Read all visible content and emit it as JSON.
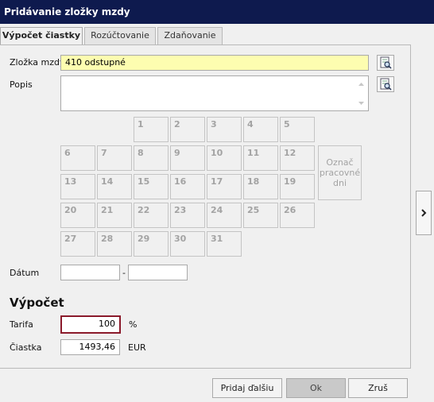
{
  "window": {
    "title": "Pridávanie zložky mzdy"
  },
  "tabs": [
    {
      "label": "Výpočet čiastky"
    },
    {
      "label": "Rozúčtovanie"
    },
    {
      "label": "Zdaňovanie"
    }
  ],
  "form": {
    "component_label": "Zložka mzdy",
    "component_value": "410  odstupné",
    "description_label": "Popis",
    "description_value": "",
    "date_label": "Dátum",
    "date_separator": "-",
    "date_from": "",
    "date_to": ""
  },
  "calendar": {
    "days": [
      "1",
      "2",
      "3",
      "4",
      "5",
      "6",
      "7",
      "8",
      "9",
      "10",
      "11",
      "12",
      "13",
      "14",
      "15",
      "16",
      "17",
      "18",
      "19",
      "20",
      "21",
      "22",
      "23",
      "24",
      "25",
      "26",
      "27",
      "28",
      "29",
      "30",
      "31"
    ],
    "mark_label": "Označ pracovné dni"
  },
  "calculation": {
    "title": "Výpočet",
    "rate_label": "Tarifa",
    "rate_value": "100",
    "rate_unit": "%",
    "amount_label": "Čiastka",
    "amount_value": "1493,46",
    "amount_unit": "EUR"
  },
  "buttons": {
    "add_next": "Pridaj ďalšiu",
    "ok": "Ok",
    "cancel": "Zruš"
  },
  "icons": {
    "lookup": "search-document-icon",
    "expand": "chevron-right-icon"
  }
}
